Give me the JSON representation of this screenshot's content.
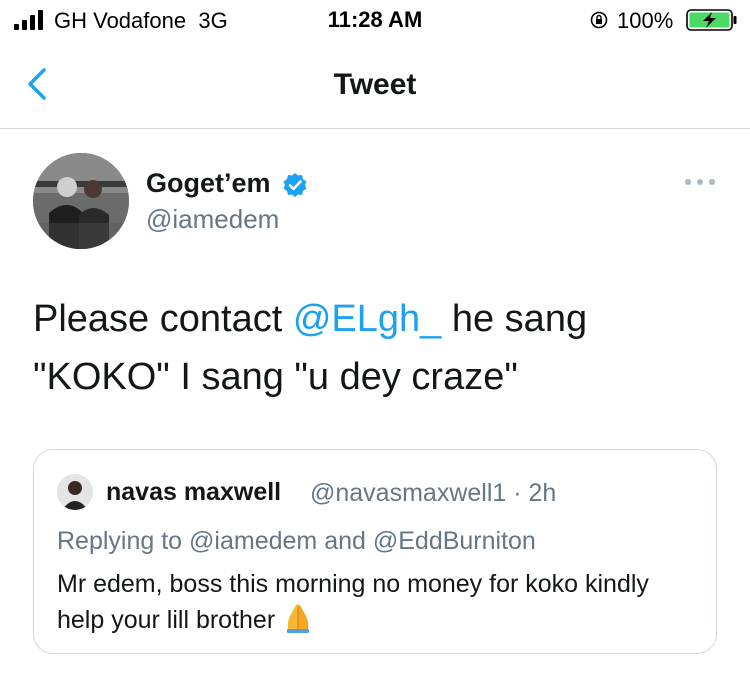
{
  "status_bar": {
    "carrier": "GH Vodafone",
    "network": "3G",
    "time": "11:28 AM",
    "battery": "100%",
    "icons": [
      "signal-icon",
      "orientation-lock-icon",
      "battery-charging-icon"
    ]
  },
  "nav": {
    "title": "Tweet",
    "back_icon": "chevron-left-icon"
  },
  "tweet": {
    "display_name": "Goget’em",
    "verified": true,
    "handle": "@iamedem",
    "text_before": "Please contact ",
    "mention": "@ELgh_",
    "text_after": " he sang \"KOKO\" I sang \"u dey craze\""
  },
  "quote": {
    "name": "navas maxwell",
    "handle": "@navasmaxwell1",
    "separator": "·",
    "time": "2h",
    "replying_prefix": "Replying to",
    "reply_to_1": "@iamedem",
    "reply_and": "and",
    "reply_to_2": "@EddBurniton",
    "text": "Mr edem, boss this morning no money for koko kindly help your lill brother",
    "emoji_icon": "praying-hands-icon"
  },
  "colors": {
    "accent": "#1da1f2",
    "secondary_text": "#657786",
    "primary_text": "#14171a",
    "battery_green": "#4cd964"
  }
}
